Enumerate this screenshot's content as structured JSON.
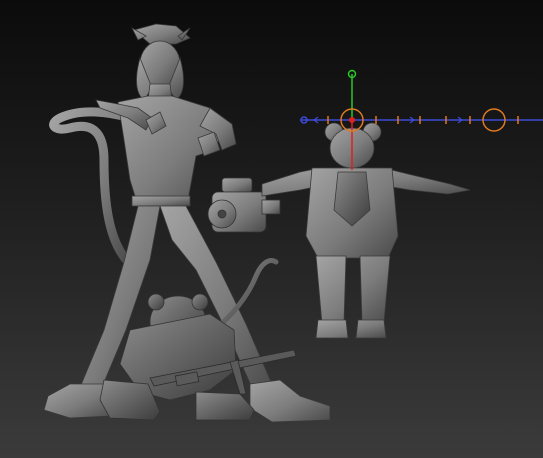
{
  "viewport": {
    "background_top": "#0b0b0b",
    "background_bottom": "#3b3b3b",
    "model_color": "#8a8a8a",
    "model_shadow": "#3e3e3e"
  },
  "gizmo": {
    "mode": "move",
    "axis_colors": {
      "x": "#3c4bd6",
      "y": "#26c926",
      "z": "#e02020"
    },
    "handle_color": "#e07a20",
    "tick_color": "#e07a20"
  },
  "models": [
    {
      "id": "cat-officer",
      "icon": "cat-officer-sculpt"
    },
    {
      "id": "rat-soldier",
      "icon": "rat-soldier-sculpt"
    },
    {
      "id": "rat-robot-tpose",
      "icon": "rat-robot-sculpt"
    },
    {
      "id": "minigun",
      "icon": "minigun-sculpt"
    }
  ]
}
